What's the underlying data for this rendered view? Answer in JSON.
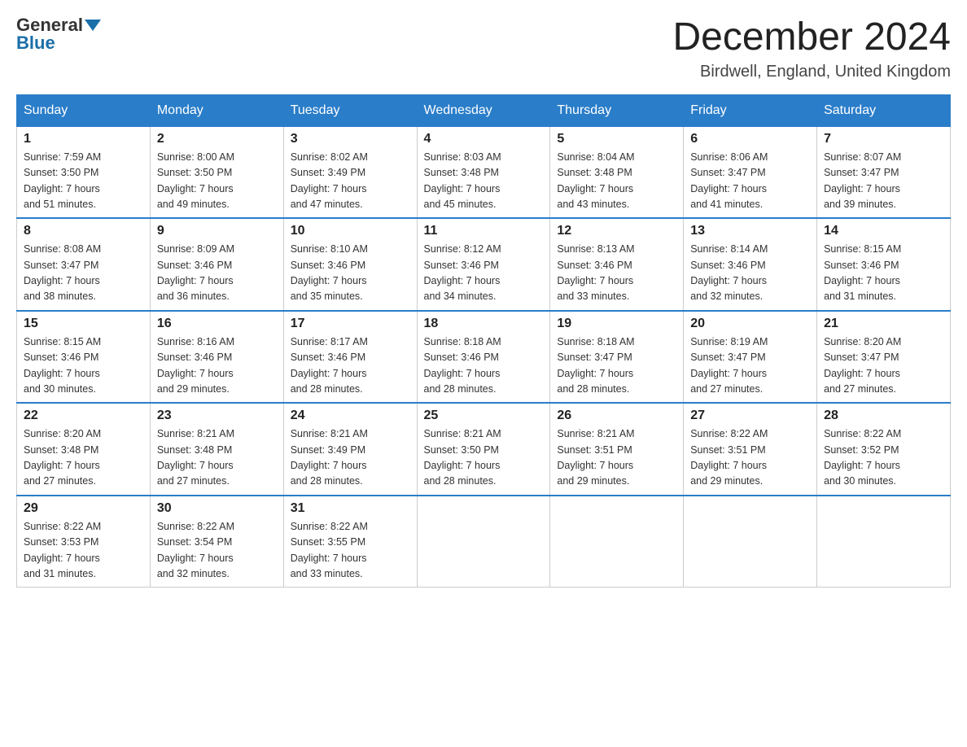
{
  "header": {
    "logo_general": "General",
    "logo_blue": "Blue",
    "month_title": "December 2024",
    "location": "Birdwell, England, United Kingdom"
  },
  "days_of_week": [
    "Sunday",
    "Monday",
    "Tuesday",
    "Wednesday",
    "Thursday",
    "Friday",
    "Saturday"
  ],
  "weeks": [
    [
      {
        "day": "1",
        "info": "Sunrise: 7:59 AM\nSunset: 3:50 PM\nDaylight: 7 hours\nand 51 minutes."
      },
      {
        "day": "2",
        "info": "Sunrise: 8:00 AM\nSunset: 3:50 PM\nDaylight: 7 hours\nand 49 minutes."
      },
      {
        "day": "3",
        "info": "Sunrise: 8:02 AM\nSunset: 3:49 PM\nDaylight: 7 hours\nand 47 minutes."
      },
      {
        "day": "4",
        "info": "Sunrise: 8:03 AM\nSunset: 3:48 PM\nDaylight: 7 hours\nand 45 minutes."
      },
      {
        "day": "5",
        "info": "Sunrise: 8:04 AM\nSunset: 3:48 PM\nDaylight: 7 hours\nand 43 minutes."
      },
      {
        "day": "6",
        "info": "Sunrise: 8:06 AM\nSunset: 3:47 PM\nDaylight: 7 hours\nand 41 minutes."
      },
      {
        "day": "7",
        "info": "Sunrise: 8:07 AM\nSunset: 3:47 PM\nDaylight: 7 hours\nand 39 minutes."
      }
    ],
    [
      {
        "day": "8",
        "info": "Sunrise: 8:08 AM\nSunset: 3:47 PM\nDaylight: 7 hours\nand 38 minutes."
      },
      {
        "day": "9",
        "info": "Sunrise: 8:09 AM\nSunset: 3:46 PM\nDaylight: 7 hours\nand 36 minutes."
      },
      {
        "day": "10",
        "info": "Sunrise: 8:10 AM\nSunset: 3:46 PM\nDaylight: 7 hours\nand 35 minutes."
      },
      {
        "day": "11",
        "info": "Sunrise: 8:12 AM\nSunset: 3:46 PM\nDaylight: 7 hours\nand 34 minutes."
      },
      {
        "day": "12",
        "info": "Sunrise: 8:13 AM\nSunset: 3:46 PM\nDaylight: 7 hours\nand 33 minutes."
      },
      {
        "day": "13",
        "info": "Sunrise: 8:14 AM\nSunset: 3:46 PM\nDaylight: 7 hours\nand 32 minutes."
      },
      {
        "day": "14",
        "info": "Sunrise: 8:15 AM\nSunset: 3:46 PM\nDaylight: 7 hours\nand 31 minutes."
      }
    ],
    [
      {
        "day": "15",
        "info": "Sunrise: 8:15 AM\nSunset: 3:46 PM\nDaylight: 7 hours\nand 30 minutes."
      },
      {
        "day": "16",
        "info": "Sunrise: 8:16 AM\nSunset: 3:46 PM\nDaylight: 7 hours\nand 29 minutes."
      },
      {
        "day": "17",
        "info": "Sunrise: 8:17 AM\nSunset: 3:46 PM\nDaylight: 7 hours\nand 28 minutes."
      },
      {
        "day": "18",
        "info": "Sunrise: 8:18 AM\nSunset: 3:46 PM\nDaylight: 7 hours\nand 28 minutes."
      },
      {
        "day": "19",
        "info": "Sunrise: 8:18 AM\nSunset: 3:47 PM\nDaylight: 7 hours\nand 28 minutes."
      },
      {
        "day": "20",
        "info": "Sunrise: 8:19 AM\nSunset: 3:47 PM\nDaylight: 7 hours\nand 27 minutes."
      },
      {
        "day": "21",
        "info": "Sunrise: 8:20 AM\nSunset: 3:47 PM\nDaylight: 7 hours\nand 27 minutes."
      }
    ],
    [
      {
        "day": "22",
        "info": "Sunrise: 8:20 AM\nSunset: 3:48 PM\nDaylight: 7 hours\nand 27 minutes."
      },
      {
        "day": "23",
        "info": "Sunrise: 8:21 AM\nSunset: 3:48 PM\nDaylight: 7 hours\nand 27 minutes."
      },
      {
        "day": "24",
        "info": "Sunrise: 8:21 AM\nSunset: 3:49 PM\nDaylight: 7 hours\nand 28 minutes."
      },
      {
        "day": "25",
        "info": "Sunrise: 8:21 AM\nSunset: 3:50 PM\nDaylight: 7 hours\nand 28 minutes."
      },
      {
        "day": "26",
        "info": "Sunrise: 8:21 AM\nSunset: 3:51 PM\nDaylight: 7 hours\nand 29 minutes."
      },
      {
        "day": "27",
        "info": "Sunrise: 8:22 AM\nSunset: 3:51 PM\nDaylight: 7 hours\nand 29 minutes."
      },
      {
        "day": "28",
        "info": "Sunrise: 8:22 AM\nSunset: 3:52 PM\nDaylight: 7 hours\nand 30 minutes."
      }
    ],
    [
      {
        "day": "29",
        "info": "Sunrise: 8:22 AM\nSunset: 3:53 PM\nDaylight: 7 hours\nand 31 minutes."
      },
      {
        "day": "30",
        "info": "Sunrise: 8:22 AM\nSunset: 3:54 PM\nDaylight: 7 hours\nand 32 minutes."
      },
      {
        "day": "31",
        "info": "Sunrise: 8:22 AM\nSunset: 3:55 PM\nDaylight: 7 hours\nand 33 minutes."
      },
      null,
      null,
      null,
      null
    ]
  ]
}
